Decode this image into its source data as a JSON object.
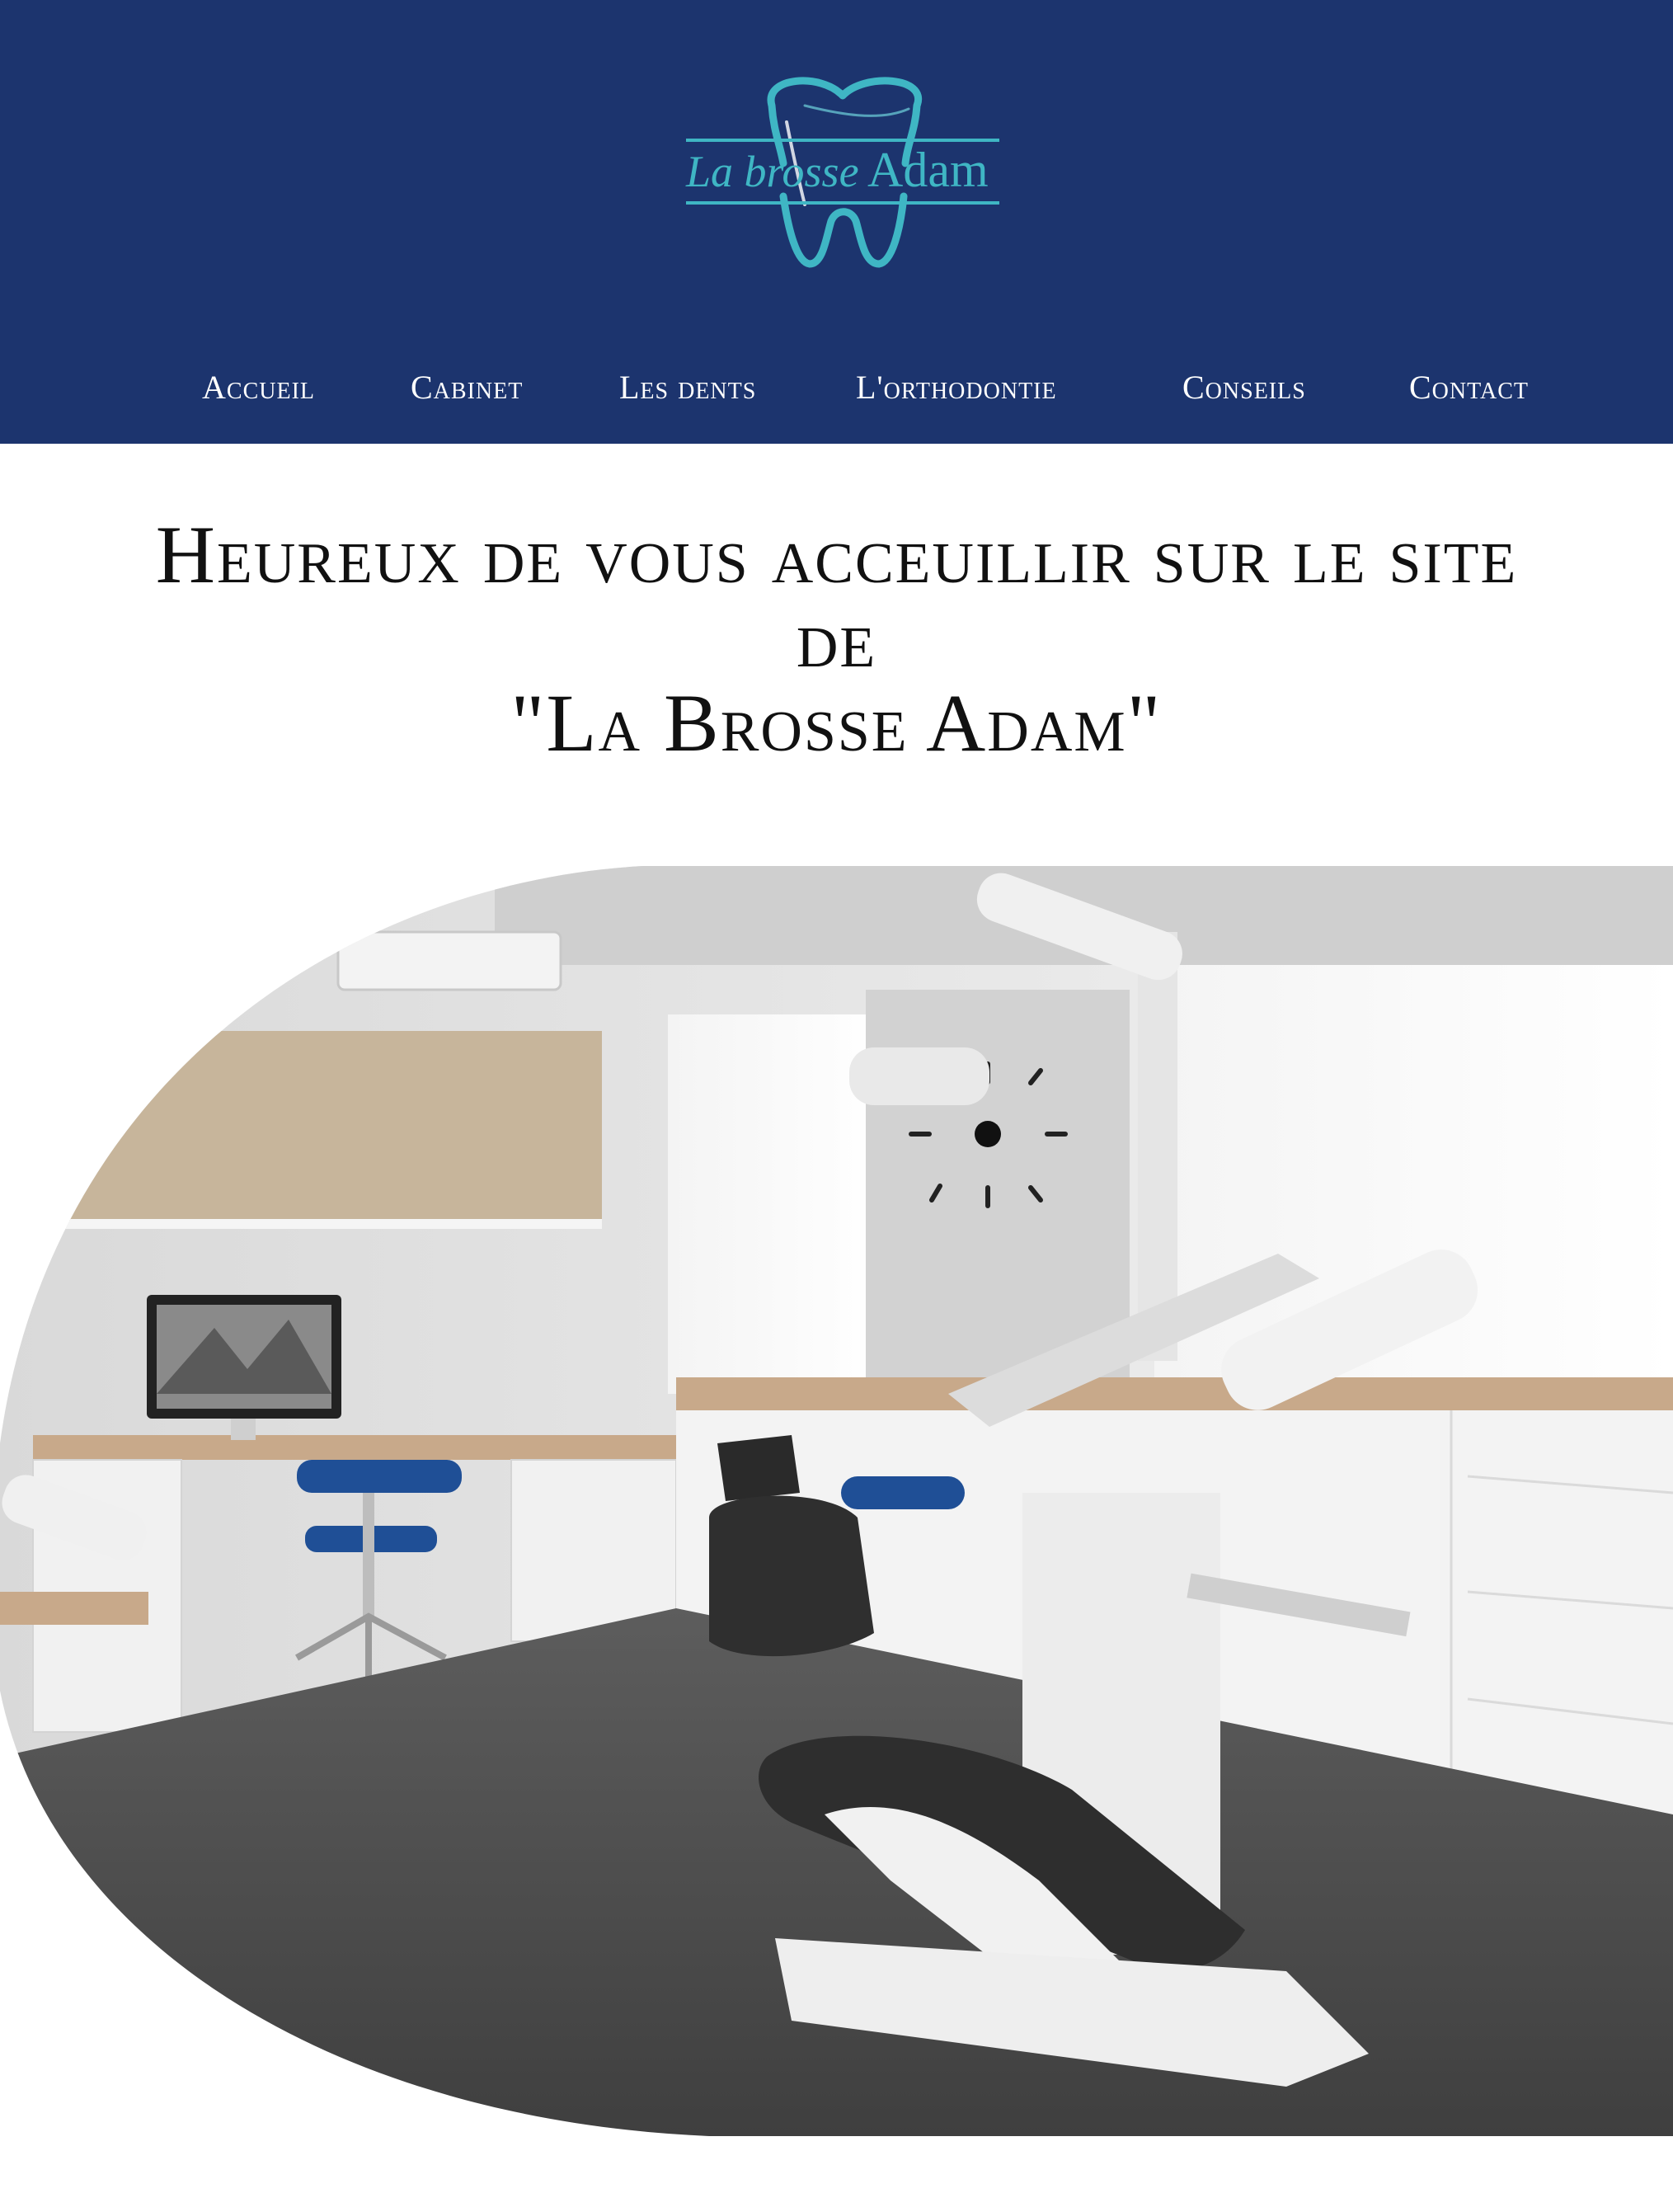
{
  "header": {
    "logo": {
      "text_script": "La brosse",
      "text_name": "Adam",
      "icon": "tooth-icon",
      "accent_color": "#3fb6c4"
    },
    "background_color": "#1c346e"
  },
  "nav": {
    "items": [
      {
        "label": "Accueil"
      },
      {
        "label": "Cabinet"
      },
      {
        "label": "Les dents"
      },
      {
        "label": "L'orthodontie"
      },
      {
        "label": "Conseils"
      },
      {
        "label": "Contact"
      }
    ]
  },
  "main": {
    "headline": {
      "line1": "Heureux de vous acceuillir sur le site",
      "line2": "de",
      "line3": "\"La Brosse Adam\""
    },
    "hero_image": {
      "subject": "dental-treatment-room-photo"
    }
  }
}
